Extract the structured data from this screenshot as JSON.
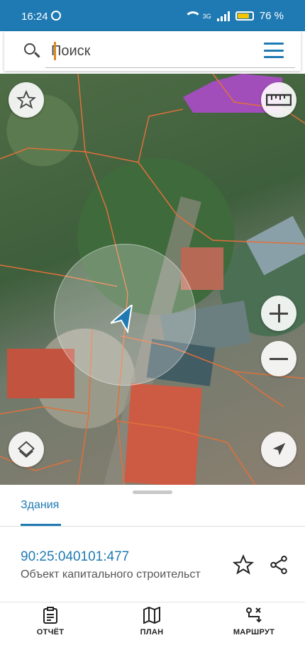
{
  "statusbar": {
    "time": "16:24",
    "battery": "76 %",
    "network": "3G"
  },
  "search": {
    "placeholder": "Поиск"
  },
  "sheet": {
    "tab_label": "Здания",
    "cadastral_number": "90:25:040101:477",
    "object_type": "Объект капитального строительст"
  },
  "nav": {
    "report": "ОТЧЁТ",
    "plan": "ПЛАН",
    "route": "МАРШРУТ"
  },
  "colors": {
    "accent": "#1f7ab3",
    "plot_border": "#e0703a",
    "highlight": "#b14ad0",
    "location_arrow": "#1f7ab3"
  }
}
